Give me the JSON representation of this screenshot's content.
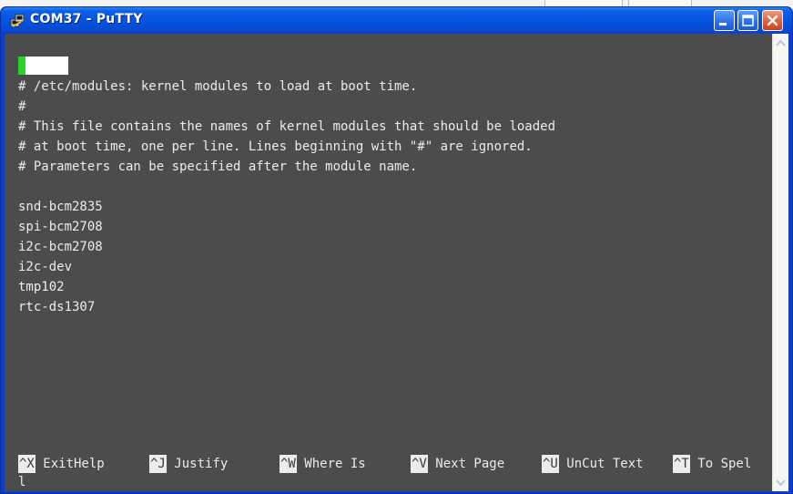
{
  "window": {
    "title": "COM37 - PuTTY",
    "controls": [
      "minimize",
      "maximize",
      "close"
    ]
  },
  "editor": {
    "lines": [
      "# /etc/modules: kernel modules to load at boot time.",
      "#",
      "# This file contains the names of kernel modules that should be loaded",
      "# at boot time, one per line. Lines beginning with \"#\" are ignored.",
      "# Parameters can be specified after the module name.",
      "",
      "snd-bcm2835",
      "spi-bcm2708",
      "i2c-bcm2708",
      "i2c-dev",
      "tmp102",
      "rtc-ds1307"
    ],
    "shortcuts": [
      {
        "key": "^X",
        "label": " ExitHelp"
      },
      {
        "key": "^J",
        "label": " Justify"
      },
      {
        "key": "^W",
        "label": " Where Is"
      },
      {
        "key": "^V",
        "label": " Next Page"
      },
      {
        "key": "^U",
        "label": " UnCut Text"
      },
      {
        "key": "^T",
        "label": " To Spel"
      }
    ],
    "wrap_line": "l"
  },
  "colors": {
    "terminal_bg": "#4c4c4c",
    "terminal_fg": "#ececec",
    "titlebar": "#0554e0",
    "cursor_accent": "#2ad42a"
  }
}
